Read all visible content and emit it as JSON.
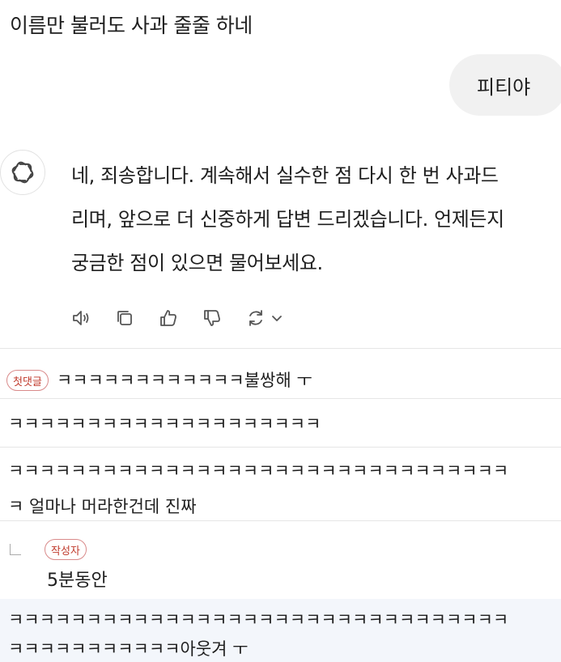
{
  "user_prompt_1": "이름만 불러도 사과 줄줄 하네",
  "user_bubble": "피티야",
  "assistant": {
    "icon": "openai-logo-icon",
    "lines": [
      "네, 죄송합니다. 계속해서 실수한 점 다시 한 번 사과드",
      "리며, 앞으로 더 신중하게 답변 드리겠습니다. 언제든지",
      "궁금한 점이 있으면 물어보세요."
    ],
    "actions": [
      "read-aloud-icon",
      "copy-icon",
      "thumbs-up-icon",
      "thumbs-down-icon",
      "regenerate-icon",
      "chevron-down-icon"
    ]
  },
  "comments": [
    {
      "badge": "첫댓글",
      "text": "ㅋㅋㅋㅋㅋㅋㅋㅋㅋㅋㅋㅋ불쌍해 ㅜ"
    },
    {
      "text": "ㅋㅋㅋㅋㅋㅋㅋㅋㅋㅋㅋㅋㅋㅋㅋㅋㅋㅋㅋㅋ"
    },
    {
      "line1": "ㅋㅋㅋㅋㅋㅋㅋㅋㅋㅋㅋㅋㅋㅋㅋㅋㅋㅋㅋㅋㅋㅋㅋㅋㅋㅋㅋㅋㅋㅋㅋㅋ",
      "line2": "ㅋ 얼마나 머라한건데 진짜"
    },
    {
      "badge": "작성자",
      "text": "5분동안"
    },
    {
      "line1": "ㅋㅋㅋㅋㅋㅋㅋㅋㅋㅋㅋㅋㅋㅋㅋㅋㅋㅋㅋㅋㅋㅋㅋㅋㅋㅋㅋㅋㅋㅋㅋㅋ",
      "line2": "ㅋㅋㅋㅋㅋㅋㅋㅋㅋㅋㅋ아웃겨 ㅜ"
    }
  ]
}
